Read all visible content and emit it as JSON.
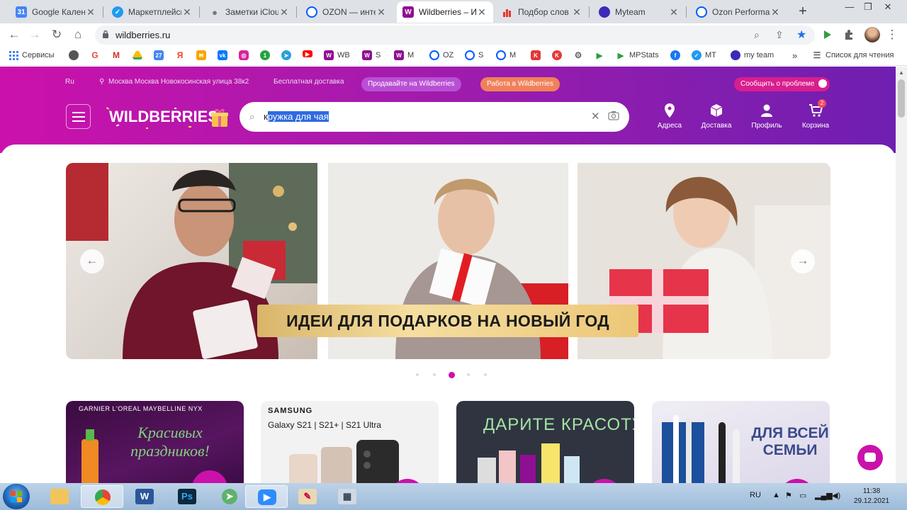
{
  "browser": {
    "tabs": [
      {
        "label": "Google Календ",
        "icon": "google-calendar-icon",
        "color": "#4285f4",
        "glyph": "31"
      },
      {
        "label": "Маркетплейсы",
        "icon": "checkmark-icon",
        "color": "#1e9bf0",
        "glyph": "✓"
      },
      {
        "label": "Заметки iCloud",
        "icon": "apple-icon",
        "color": "#888888",
        "glyph": ""
      },
      {
        "label": "OZON — интер",
        "icon": "ozon-icon",
        "color": "#005bff",
        "glyph": "O"
      },
      {
        "label": "Wildberries – И",
        "icon": "wildberries-icon",
        "color": "#8f0f93",
        "glyph": "W"
      },
      {
        "label": "Подбор слов",
        "icon": "chart-icon",
        "color": "#e8332e",
        "glyph": "▮"
      },
      {
        "label": "Myteam",
        "icon": "myteam-icon",
        "color": "#3b2bb8",
        "glyph": "●"
      },
      {
        "label": "Ozon Performa",
        "icon": "ozon-performance-icon",
        "color": "#005bff",
        "glyph": "O"
      }
    ],
    "url": "wildberries.ru",
    "bookmarks": [
      {
        "label": "Сервисы",
        "icon": "apps-grid-icon",
        "color": "#4285f4"
      },
      {
        "label": "",
        "icon": "apple-icon",
        "color": "#555555"
      },
      {
        "label": "",
        "icon": "google-icon",
        "color": "#ea4335"
      },
      {
        "label": "",
        "icon": "gmail-icon",
        "color": "#d93025"
      },
      {
        "label": "",
        "icon": "google-drive-icon",
        "color": "#fbbc04"
      },
      {
        "label": "",
        "icon": "calendar-icon",
        "color": "#4285f4"
      },
      {
        "label": "",
        "icon": "yandex-icon",
        "color": "#fc3f1d"
      },
      {
        "label": "",
        "icon": "mail-icon",
        "color": "#f7a600"
      },
      {
        "label": "",
        "icon": "vk-icon",
        "color": "#0077ff"
      },
      {
        "label": "",
        "icon": "instagram-icon",
        "color": "#d6249f"
      },
      {
        "label": "",
        "icon": "one-icon",
        "color": "#25a244"
      },
      {
        "label": "",
        "icon": "telegram-icon",
        "color": "#2aa1da"
      },
      {
        "label": "",
        "icon": "youtube-icon",
        "color": "#ff0000"
      },
      {
        "label": "WB",
        "icon": "wildberries-icon",
        "color": "#8f0f93"
      },
      {
        "label": "S",
        "icon": "wildberries-icon",
        "color": "#8f0f93"
      },
      {
        "label": "M",
        "icon": "wildberries-icon",
        "color": "#8f0f93"
      },
      {
        "label": "OZ",
        "icon": "ozon-icon",
        "color": "#005bff"
      },
      {
        "label": "S",
        "icon": "ozon-icon",
        "color": "#005bff"
      },
      {
        "label": "M",
        "icon": "ozon-icon",
        "color": "#005bff"
      },
      {
        "label": "",
        "icon": "k-icon",
        "color": "#e53935"
      },
      {
        "label": "",
        "icon": "k-circle-icon",
        "color": "#e53935"
      },
      {
        "label": "",
        "icon": "gear-icon",
        "color": "#666666"
      },
      {
        "label": "",
        "icon": "play-icon",
        "color": "#2e9e44"
      },
      {
        "label": "MPStats",
        "icon": "mpstats-icon",
        "color": "#2e9e44"
      },
      {
        "label": "",
        "icon": "facebook-icon",
        "color": "#1877f2"
      },
      {
        "label": "MT",
        "icon": "checkmark-icon",
        "color": "#1e9bf0"
      },
      {
        "label": "my team",
        "icon": "myteam-icon",
        "color": "#3b2bb8"
      }
    ],
    "reading_list": "Список для чтения"
  },
  "wb": {
    "lang": "Ru",
    "location": "Москва Москва Новокосинская улица 38к2",
    "free_delivery": "Бесплатная доставка",
    "sell_button": "Продавайте на Wildberries",
    "work_button": "Работа в Wildberries",
    "report_button": "Сообщить о проблеме",
    "logo": "WILDBERRIES",
    "search_prefix": "к",
    "search_selected": "ружка для чая",
    "nav": [
      {
        "label": "Адреса",
        "icon": "location-pin-icon"
      },
      {
        "label": "Доставка",
        "icon": "box-icon"
      },
      {
        "label": "Профиль",
        "icon": "person-icon"
      },
      {
        "label": "Корзина",
        "icon": "cart-icon"
      }
    ],
    "cart_count": "2",
    "banner_text": "ИДЕИ ДЛЯ ПОДАРКОВ НА НОВЫЙ ГОД",
    "cards": [
      {
        "top": "GARNIER L'OREAL MAYBELLINE NYX",
        "title": "Красивых праздников!"
      },
      {
        "top": "SAMSUNG",
        "title": "Galaxy S21 | S21+ | S21 Ultra"
      },
      {
        "top": "",
        "title": "ДАРИТЕ КРАСОТУ!"
      },
      {
        "top": "",
        "title": "ДЛЯ ВСЕЙ СЕМЬИ"
      }
    ]
  },
  "taskbar": {
    "lang": "RU",
    "time": "11:38",
    "date": "29.12.2021"
  }
}
